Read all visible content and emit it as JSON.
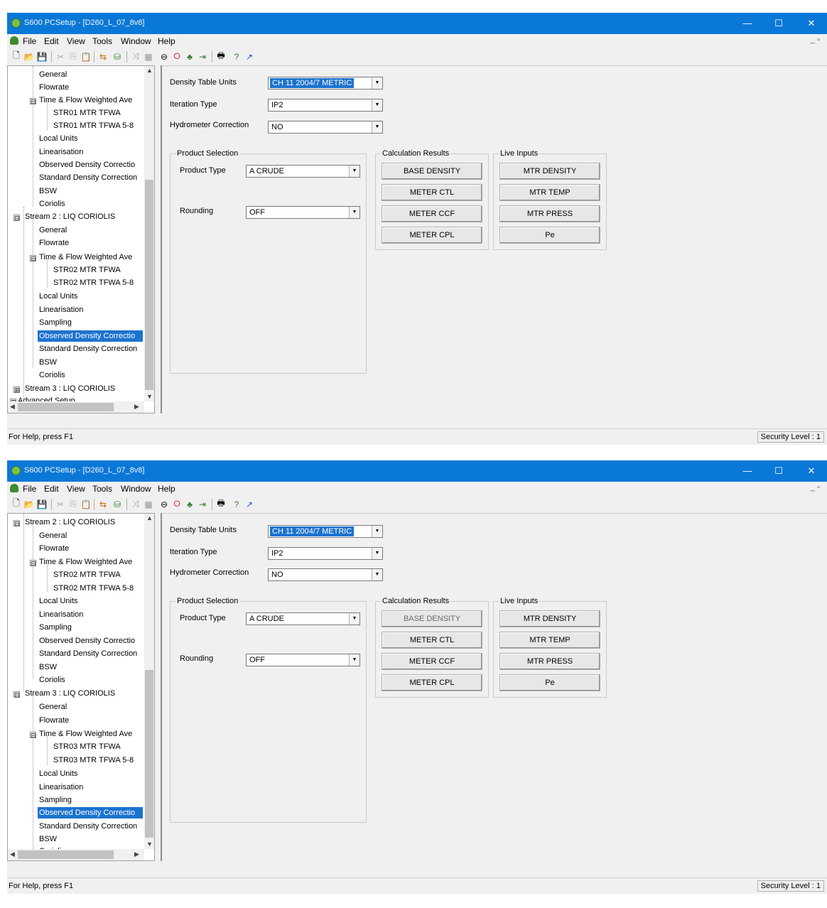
{
  "windows": [
    {
      "title": "S600 PCSetup - [D260_L_07_8v8]",
      "window_controls": {
        "minimize": "—",
        "maximize": "☐",
        "close": "✕"
      },
      "menu": [
        "File",
        "Edit",
        "View",
        "Tools",
        "Window",
        "Help"
      ],
      "menu_mdi": "_ ▫",
      "toolbar_icons": [
        "new-icon",
        "open-icon",
        "save-icon",
        "cut-icon",
        "copy-icon",
        "paste-icon",
        "connect-icon",
        "transfer-icon",
        "link-icon",
        "grid-icon",
        "loop-icon",
        "stop-icon",
        "run-icon",
        "step-icon",
        "print-icon",
        "help-icon",
        "context-help-icon"
      ],
      "tree": {
        "items": [
          {
            "label": "General",
            "level": 2
          },
          {
            "label": "Flowrate",
            "level": 2
          },
          {
            "label": "Time & Flow Weighted Ave",
            "level": 2,
            "expander": "⊟"
          },
          {
            "label": "STR01 MTR TFWA",
            "level": 3
          },
          {
            "label": "STR01 MTR TFWA 5-8",
            "level": 3
          },
          {
            "label": "Local Units",
            "level": 2
          },
          {
            "label": "Linearisation",
            "level": 2
          },
          {
            "label": "Observed Density Correctio",
            "level": 2
          },
          {
            "label": "Standard Density Correction",
            "level": 2
          },
          {
            "label": "BSW",
            "level": 2
          },
          {
            "label": "Coriolis",
            "level": 2
          },
          {
            "label": "Stream 2 : LIQ CORIOLIS",
            "level": 1,
            "expander": "⊟"
          },
          {
            "label": "General",
            "level": 2
          },
          {
            "label": "Flowrate",
            "level": 2
          },
          {
            "label": "Time & Flow Weighted Ave",
            "level": 2,
            "expander": "⊟"
          },
          {
            "label": "STR02 MTR TFWA",
            "level": 3
          },
          {
            "label": "STR02 MTR TFWA 5-8",
            "level": 3
          },
          {
            "label": "Local Units",
            "level": 2
          },
          {
            "label": "Linearisation",
            "level": 2
          },
          {
            "label": "Sampling",
            "level": 2
          },
          {
            "label": "Observed Density Correctio",
            "level": 2,
            "selected": true
          },
          {
            "label": "Standard Density Correction",
            "level": 2
          },
          {
            "label": "BSW",
            "level": 2
          },
          {
            "label": "Coriolis",
            "level": 2
          },
          {
            "label": "Stream 3 : LIQ CORIOLIS",
            "level": 1,
            "expander": "⊞"
          },
          {
            "label": "Advanced Setup",
            "level": 0,
            "expander": "⊞"
          }
        ]
      },
      "form": {
        "density_table_units_label": "Density Table Units",
        "density_table_units_value": "CH 11 2004/7 METRIC",
        "iteration_type_label": "Iteration Type",
        "iteration_type_value": "IP2",
        "hydrometer_correction_label": "Hydrometer Correction",
        "hydrometer_correction_value": "NO",
        "product_selection_title": "Product Selection",
        "product_type_label": "Product Type",
        "product_type_value": "A CRUDE",
        "rounding_label": "Rounding",
        "rounding_value": "OFF",
        "calc_results_title": "Calculation Results",
        "calc_buttons": [
          "BASE DENSITY",
          "METER CTL",
          "METER CCF",
          "METER CPL"
        ],
        "live_inputs_title": "Live Inputs",
        "live_buttons": [
          "MTR DENSITY",
          "MTR TEMP",
          "MTR PRESS",
          "Pe"
        ]
      },
      "status_left": "For Help, press F1",
      "status_right": "Security Level : 1"
    },
    {
      "title": "S600 PCSetup - [D260_L_07_8v8]",
      "window_controls": {
        "minimize": "—",
        "maximize": "☐",
        "close": "✕"
      },
      "menu": [
        "File",
        "Edit",
        "View",
        "Tools",
        "Window",
        "Help"
      ],
      "menu_mdi": "_ ▫",
      "toolbar_icons": [
        "new-icon",
        "open-icon",
        "save-icon",
        "cut-icon",
        "copy-icon",
        "paste-icon",
        "connect-icon",
        "transfer-icon",
        "link-icon",
        "grid-icon",
        "loop-icon",
        "stop-icon",
        "run-icon",
        "step-icon",
        "print-icon",
        "help-icon",
        "context-help-icon"
      ],
      "tree": {
        "items": [
          {
            "label": "Stream 2 : LIQ CORIOLIS",
            "level": 1,
            "expander": "⊟"
          },
          {
            "label": "General",
            "level": 2
          },
          {
            "label": "Flowrate",
            "level": 2
          },
          {
            "label": "Time & Flow Weighted Ave",
            "level": 2,
            "expander": "⊟"
          },
          {
            "label": "STR02 MTR TFWA",
            "level": 3
          },
          {
            "label": "STR02 MTR TFWA 5-8",
            "level": 3
          },
          {
            "label": "Local Units",
            "level": 2
          },
          {
            "label": "Linearisation",
            "level": 2
          },
          {
            "label": "Sampling",
            "level": 2
          },
          {
            "label": "Observed Density Correctio",
            "level": 2
          },
          {
            "label": "Standard Density Correction",
            "level": 2
          },
          {
            "label": "BSW",
            "level": 2
          },
          {
            "label": "Coriolis",
            "level": 2
          },
          {
            "label": "Stream 3 : LIQ CORIOLIS",
            "level": 1,
            "expander": "⊟"
          },
          {
            "label": "General",
            "level": 2
          },
          {
            "label": "Flowrate",
            "level": 2
          },
          {
            "label": "Time & Flow Weighted Ave",
            "level": 2,
            "expander": "⊟"
          },
          {
            "label": "STR03 MTR TFWA",
            "level": 3
          },
          {
            "label": "STR03 MTR TFWA 5-8",
            "level": 3
          },
          {
            "label": "Local Units",
            "level": 2
          },
          {
            "label": "Linearisation",
            "level": 2
          },
          {
            "label": "Sampling",
            "level": 2
          },
          {
            "label": "Observed Density Correctio",
            "level": 2,
            "selected": true
          },
          {
            "label": "Standard Density Correction",
            "level": 2
          },
          {
            "label": "BSW",
            "level": 2
          },
          {
            "label": "Coriolis",
            "level": 2
          }
        ]
      },
      "form": {
        "density_table_units_label": "Density Table Units",
        "density_table_units_value": "CH 11 2004/7 METRIC",
        "iteration_type_label": "Iteration Type",
        "iteration_type_value": "IP2",
        "hydrometer_correction_label": "Hydrometer Correction",
        "hydrometer_correction_value": "NO",
        "product_selection_title": "Product Selection",
        "product_type_label": "Product Type",
        "product_type_value": "A CRUDE",
        "rounding_label": "Rounding",
        "rounding_value": "OFF",
        "calc_results_title": "Calculation Results",
        "calc_buttons": [
          "BASE DENSITY",
          "METER CTL",
          "METER CCF",
          "METER CPL"
        ],
        "live_inputs_title": "Live Inputs",
        "live_buttons": [
          "MTR DENSITY",
          "MTR TEMP",
          "MTR PRESS",
          "Pe"
        ]
      },
      "status_left": "For Help, press F1",
      "status_right": "Security Level : 1"
    }
  ]
}
